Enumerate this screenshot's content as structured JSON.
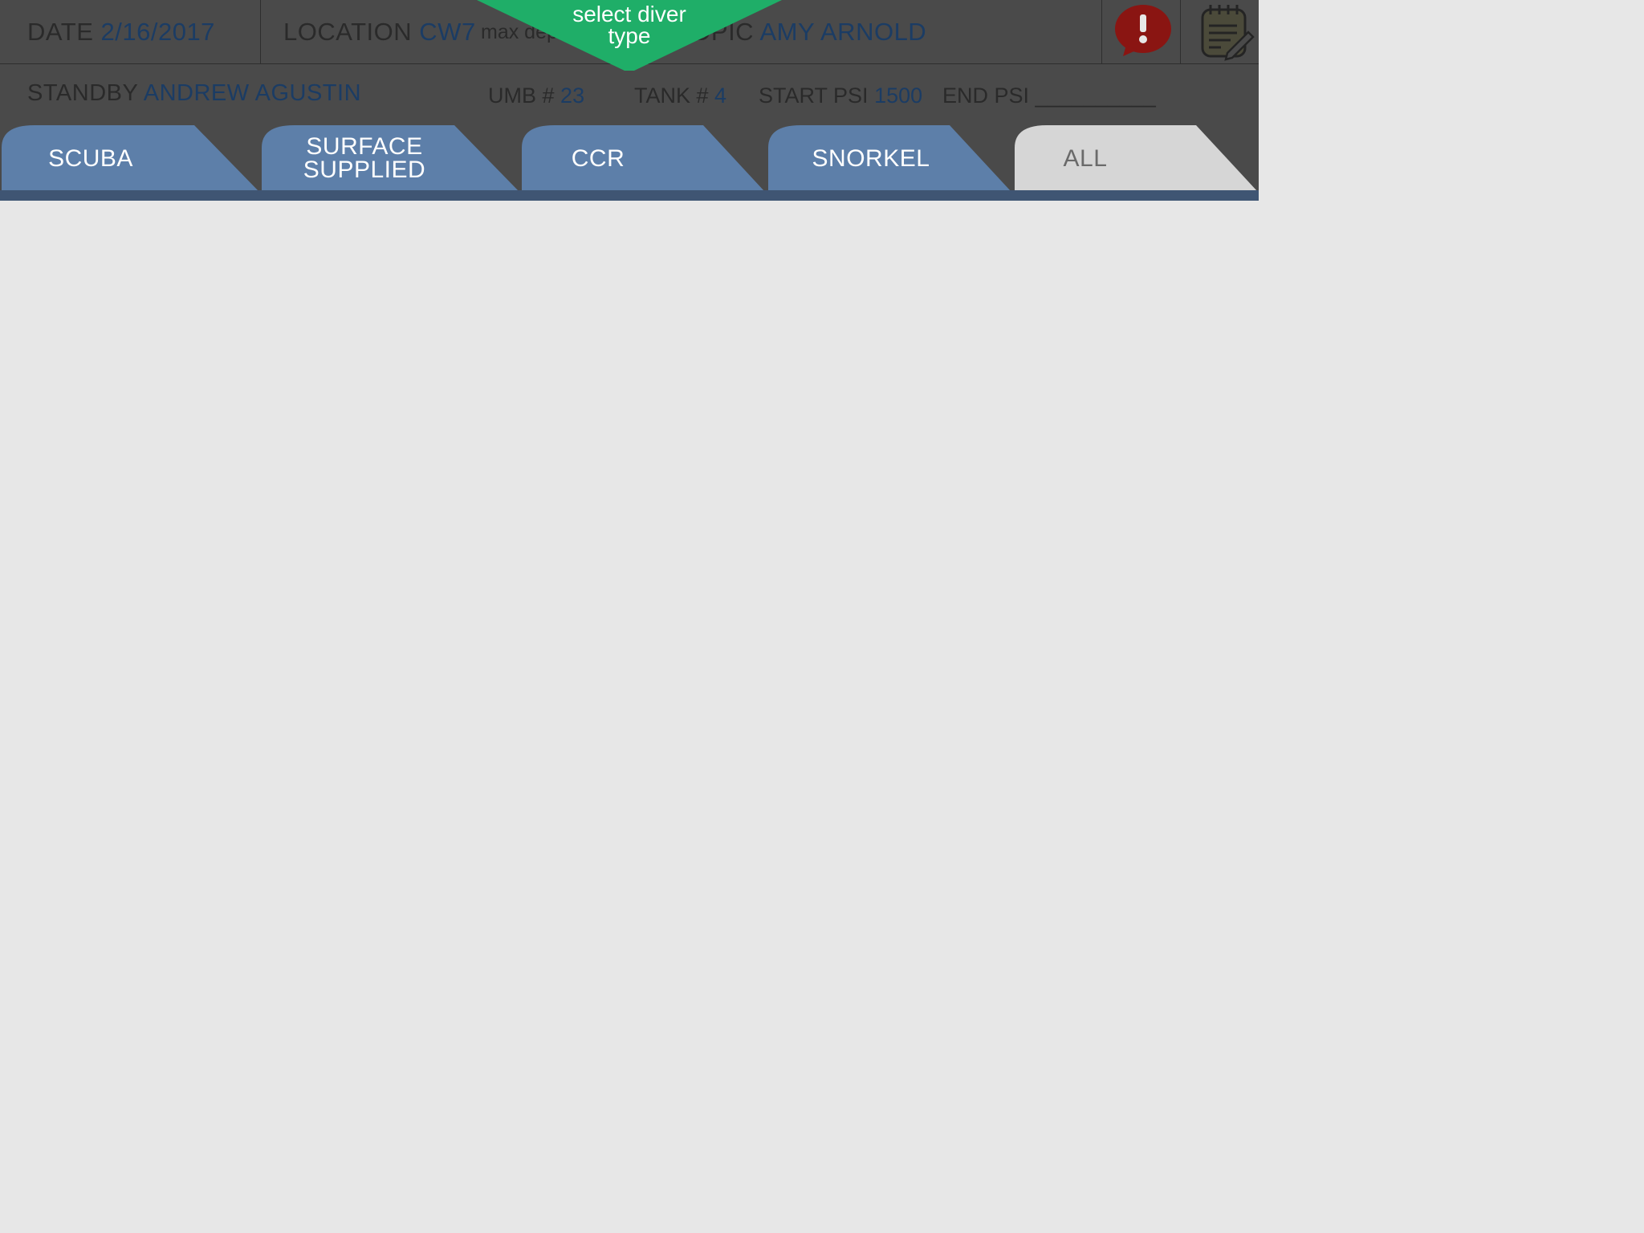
{
  "header": {
    "date_label": "DATE",
    "date_value": "2/16/2017",
    "location_label": "LOCATION",
    "location_value": "CW7",
    "max_depth_label": "max dept",
    "dpic_label": "DPIC",
    "dpic_value": "AMY ARNOLD"
  },
  "details": {
    "standby_label": "STANDBY",
    "standby_value": "ANDREW AGUSTIN",
    "umb_label": "UMB #",
    "umb_value": "23",
    "tank_label": "TANK #",
    "tank_value": "4",
    "start_psi_label": "START PSI",
    "start_psi_value": "1500",
    "end_psi_label": "END PSI",
    "end_psi_value": "__________"
  },
  "tooltip": {
    "line1": "select diver",
    "line2": "type"
  },
  "tabs": [
    {
      "label": "SCUBA"
    },
    {
      "label1": "SURFACE",
      "label2": "SUPPLIED"
    },
    {
      "label": "CCR"
    },
    {
      "label": "SNORKEL"
    },
    {
      "label": "ALL"
    }
  ],
  "active_tab": "ALL",
  "icons": {
    "alert": "alert-bubble-icon",
    "notes": "notepad-edit-icon"
  },
  "colors": {
    "tab_blue": "#5d7fa9",
    "tab_active": "#d6d6d6",
    "tooltip_green": "#1fae68",
    "alert_red": "#8a1512",
    "value_text": "#1b3c64"
  }
}
